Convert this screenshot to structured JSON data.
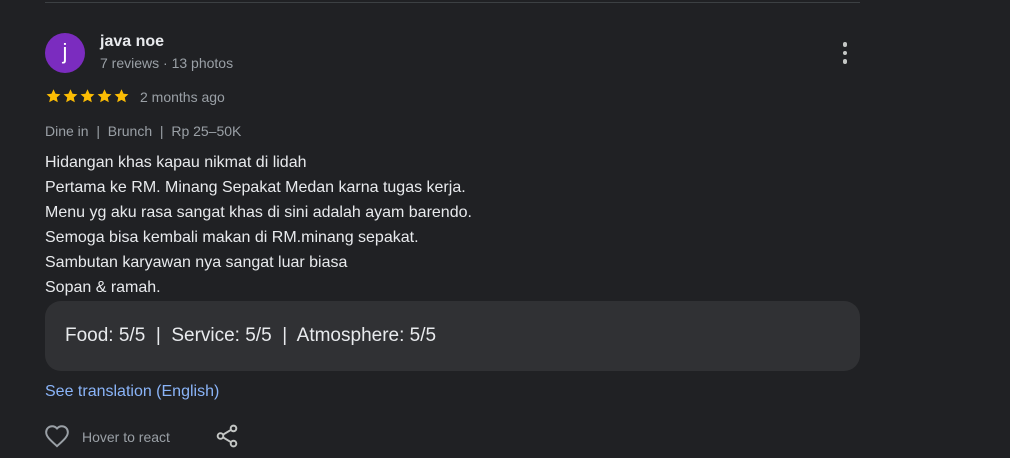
{
  "review": {
    "avatar_letter": "j",
    "author_name": "java noe",
    "author_meta": "7 reviews · 13 photos",
    "rating_stars": 5,
    "rating_max": 5,
    "time_ago": "2 months ago",
    "visit_info": "Dine in  |  Brunch  |  Rp 25–50K",
    "text_lines": [
      "Hidangan khas kapau nikmat di lidah",
      "Pertama ke RM. Minang Sepakat Medan karna tugas kerja.",
      "Menu yg aku rasa sangat khas di sini adalah ayam barendo.",
      "Semoga bisa kembali makan di RM.minang sepakat.",
      "Sambutan karyawan nya sangat luar biasa",
      "Sopan & ramah."
    ],
    "sub_ratings": "Food: 5/5  |  Service: 5/5  |  Atmosphere: 5/5",
    "see_translation": "See translation (English)",
    "react_label": "Hover to react"
  },
  "icons": {
    "more": "more-vert-icon",
    "star": "star-icon",
    "like": "heart-outline-icon",
    "share": "share-icon"
  },
  "colors": {
    "background": "#202124",
    "avatar": "#7b2cbf",
    "star": "#fbbc04",
    "link": "#8ab4f8",
    "secondary_text": "#9aa0a6",
    "ratings_box": "#303134"
  }
}
